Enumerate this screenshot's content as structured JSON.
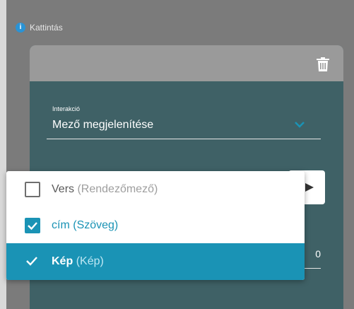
{
  "section": {
    "title": "Kattintás",
    "info_icon": "info-icon"
  },
  "card": {
    "delete_icon": "trash-icon",
    "field": {
      "label": "Interakció",
      "value": "Mező megjelenítése",
      "chevron_icon": "chevron-down-icon"
    },
    "button_icon": "play-icon",
    "peek_value": "0"
  },
  "dropdown": {
    "options": [
      {
        "name": "Vers",
        "type": "(Rendezőmező)",
        "checked": false,
        "highlighted": false
      },
      {
        "name": "cím",
        "type": "(Szöveg)",
        "checked": true,
        "highlighted": false
      },
      {
        "name": "Kép",
        "type": "(Kép)",
        "checked": true,
        "highlighted": true
      }
    ]
  },
  "colors": {
    "accent": "#1a93b5",
    "card_body": "#3f6166",
    "card_header": "#9a9a9a",
    "page_bg": "#7b7b7b",
    "info": "#2a93d5"
  }
}
